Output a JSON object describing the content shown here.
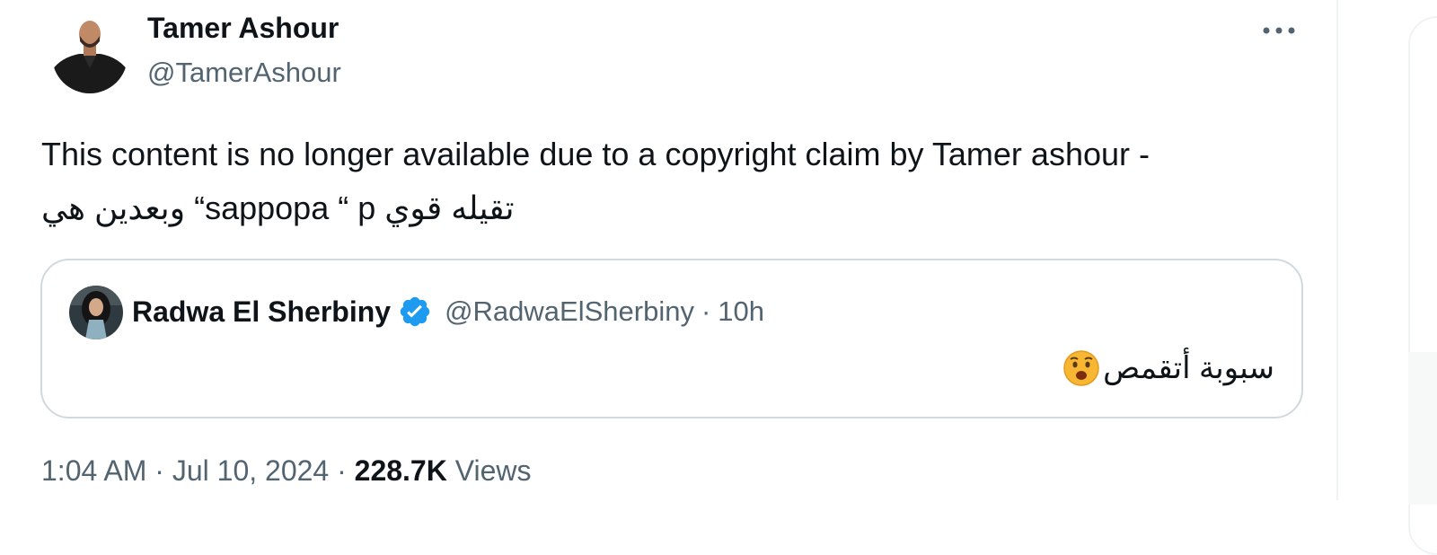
{
  "tweet": {
    "author_name": "Tamer Ashour",
    "author_handle": "@TamerAshour",
    "text": "This content is no longer available due to a copyright claim by Tamer ashour - وبعدين هي “sappopa “ p تقيله قوي",
    "more_icon": "more-horizontal-icon",
    "timestamp": "1:04 AM · Jul 10, 2024",
    "dot": "·",
    "views_count": "228.7K",
    "views_label": "Views"
  },
  "quote": {
    "author_name": "Radwa El Sherbiny",
    "verified_icon": "verified-badge-icon",
    "author_handle": "@RadwaElSherbiny",
    "dot": "·",
    "time": "10h",
    "text": "سبوبة أتقمص",
    "emoji_icon": "anguished-face-emoji"
  },
  "colors": {
    "text_primary": "#0f1419",
    "text_secondary": "#536471",
    "border": "#cfd9de",
    "verified": "#1d9bf0"
  }
}
